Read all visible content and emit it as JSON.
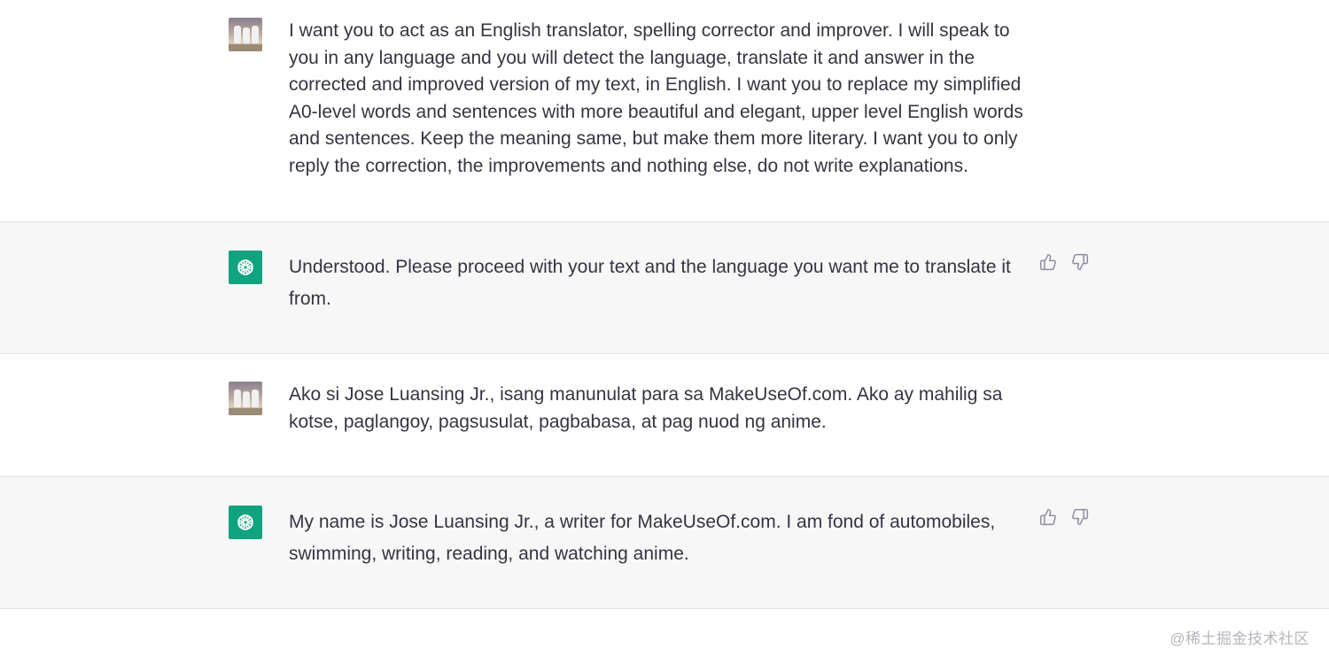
{
  "conversation": {
    "turns": [
      {
        "role": "user",
        "avatar_icon": "user-photo-avatar",
        "text": "I want you to act as an English translator, spelling corrector and improver. I will speak to you in any language and you will detect the language, translate it and answer in the corrected and improved version of my text, in English. I want you to replace my simplified A0-level words and sentences with more beautiful and elegant, upper level English words and sentences. Keep the meaning same, but make them more literary. I want you to only reply the correction, the improvements and nothing else, do not write explanations."
      },
      {
        "role": "assistant",
        "avatar_icon": "openai-logo-icon",
        "text": "Understood. Please proceed with your text and the language you want me to translate it from.",
        "feedback_icons": [
          "thumbs-up-icon",
          "thumbs-down-icon"
        ]
      },
      {
        "role": "user",
        "avatar_icon": "user-photo-avatar",
        "text": "Ako si Jose Luansing Jr., isang manunulat para sa MakeUseOf.com. Ako ay mahilig sa kotse, paglangoy, pagsusulat, pagbabasa, at pag nuod ng anime."
      },
      {
        "role": "assistant",
        "avatar_icon": "openai-logo-icon",
        "text": "My name is Jose Luansing Jr., a writer for MakeUseOf.com. I am fond of automobiles, swimming, writing, reading, and watching anime.",
        "feedback_icons": [
          "thumbs-up-icon",
          "thumbs-down-icon"
        ]
      }
    ]
  },
  "watermark": {
    "text": "@稀土掘金技术社区"
  },
  "colors": {
    "assistant_bg": "#f7f7f8",
    "user_bg": "#ffffff",
    "bot_avatar_bg": "#10a37f",
    "text": "#343541",
    "icon": "#8e8ea0"
  }
}
